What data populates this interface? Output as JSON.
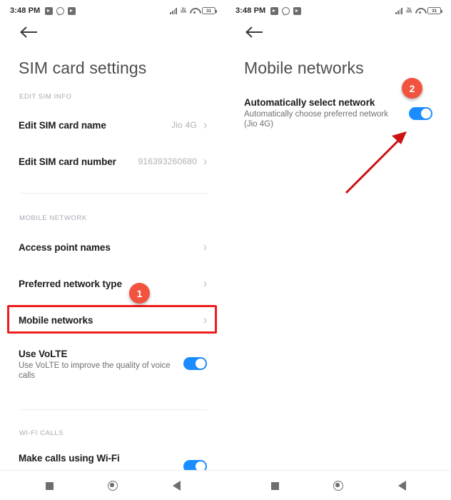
{
  "status_bar": {
    "time": "3:48 PM",
    "battery_level": "31",
    "left_icons": [
      "video-app-icon",
      "whatsapp-icon",
      "video-app-icon"
    ],
    "right_icons": [
      "signal-bars-icon",
      "volte-icon",
      "wifi-icon",
      "battery-icon"
    ],
    "volte_label_top": "Vo",
    "volte_label_bottom": "WN"
  },
  "left_screen": {
    "back_icon": "back-arrow-icon",
    "title": "SIM card settings",
    "sections": [
      {
        "label": "EDIT SIM INFO",
        "rows": [
          {
            "title": "Edit SIM card name",
            "value": "Jio 4G",
            "chevron": "›"
          },
          {
            "title": "Edit SIM card number",
            "value": "916393260680",
            "chevron": "›"
          }
        ]
      },
      {
        "label": "MOBILE NETWORK",
        "rows": [
          {
            "title": "Access point names",
            "value": "",
            "chevron": "›"
          },
          {
            "title": "Preferred network type",
            "value": "",
            "chevron": "›"
          },
          {
            "title": "Mobile networks",
            "value": "",
            "chevron": "›"
          }
        ]
      }
    ],
    "volte": {
      "title": "Use VoLTE",
      "subtitle": "Use VoLTE to improve the quality of voice calls",
      "toggle_on": true
    },
    "wifi_calls": {
      "label": "WI-FI CALLS",
      "title": "Make calls using Wi-Fi",
      "toggle_on": true
    }
  },
  "right_screen": {
    "back_icon": "back-arrow-icon",
    "title": "Mobile networks",
    "auto_select": {
      "title": "Automatically select network",
      "subtitle": "Automatically choose preferred network (Jio 4G)",
      "toggle_on": true
    }
  },
  "annotations": {
    "badge_one": "1",
    "badge_two": "2",
    "highlight_color": "#ee1c1c",
    "badge_color": "#f2533f",
    "arrow_color": "#cc1111"
  },
  "nav_bar": {
    "buttons": [
      "recents-button",
      "home-button",
      "back-button"
    ]
  }
}
